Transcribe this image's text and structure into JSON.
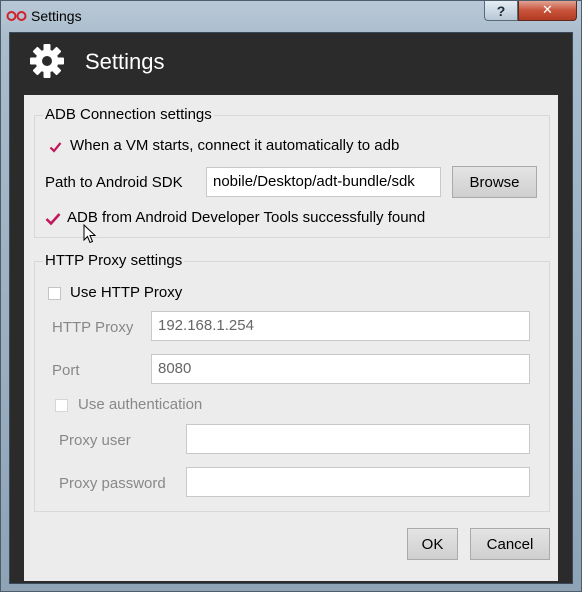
{
  "window": {
    "title": "Settings",
    "help_label": "?",
    "close_label": "✕"
  },
  "header": {
    "title": "Settings",
    "icon": "gear-icon"
  },
  "adb": {
    "group_title": "ADB Connection settings",
    "auto_connect_label": "When a VM starts, connect it automatically to adb",
    "auto_connect_checked": true,
    "sdk_path_label": "Path to Android SDK",
    "sdk_path_value": "nobile/Desktop/adt-bundle/sdk",
    "browse_label": "Browse",
    "status_text": "ADB from Android Developer Tools successfully found"
  },
  "proxy": {
    "group_title": "HTTP Proxy settings",
    "use_proxy_label": "Use HTTP Proxy",
    "use_proxy_checked": false,
    "proxy_label": "HTTP Proxy",
    "proxy_value": "192.168.1.254",
    "port_label": "Port",
    "port_value": "8080",
    "use_auth_label": "Use authentication",
    "use_auth_checked": false,
    "user_label": "Proxy user",
    "user_value": "",
    "password_label": "Proxy password",
    "password_value": ""
  },
  "footer": {
    "ok_label": "OK",
    "cancel_label": "Cancel"
  },
  "colors": {
    "accent": "#c2185b",
    "header_bg": "#2b2b2b",
    "panel_bg": "#ececec"
  }
}
